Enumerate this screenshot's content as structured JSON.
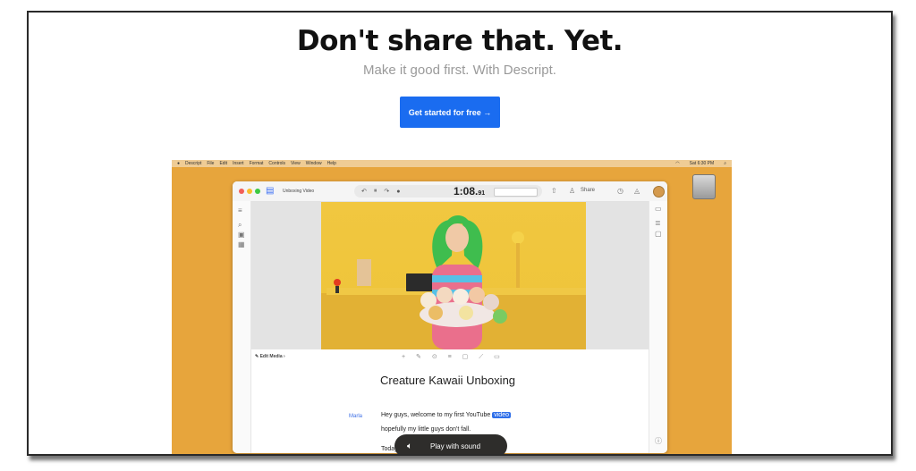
{
  "hero": {
    "headline": "Don't share that. Yet.",
    "subheadline": "Make it good first. With Descript.",
    "cta_label": "Get started for free →"
  },
  "macos": {
    "menu_items": [
      "Descript",
      "File",
      "Edit",
      "Insert",
      "Format",
      "Controls",
      "View",
      "Window",
      "Help"
    ],
    "clock": "Sat 6:30 PM"
  },
  "app": {
    "document_title": "Unboxing Video",
    "timecode_main": "1:08.",
    "timecode_frames": "91",
    "share_label": "Share",
    "edit_media_label": "Edit Media",
    "script_title": "Creature Kawaii Unboxing",
    "speaker": "Marla",
    "line1_before": "Hey guys, welcome to my first YouTube",
    "line1_highlight": "video",
    "line2": "hopefully my little guys don't fall.",
    "line3": "Today"
  },
  "overlay": {
    "play_with_sound": "Play with sound"
  },
  "colors": {
    "accent_blue": "#1a6cf0",
    "desktop_orange": "#e7a53c",
    "video_yellow": "#f1c740"
  },
  "icons": [
    "speaker-icon",
    "apple-icon",
    "document-icon",
    "play-pause-icon",
    "share-icon",
    "help-icon"
  ]
}
